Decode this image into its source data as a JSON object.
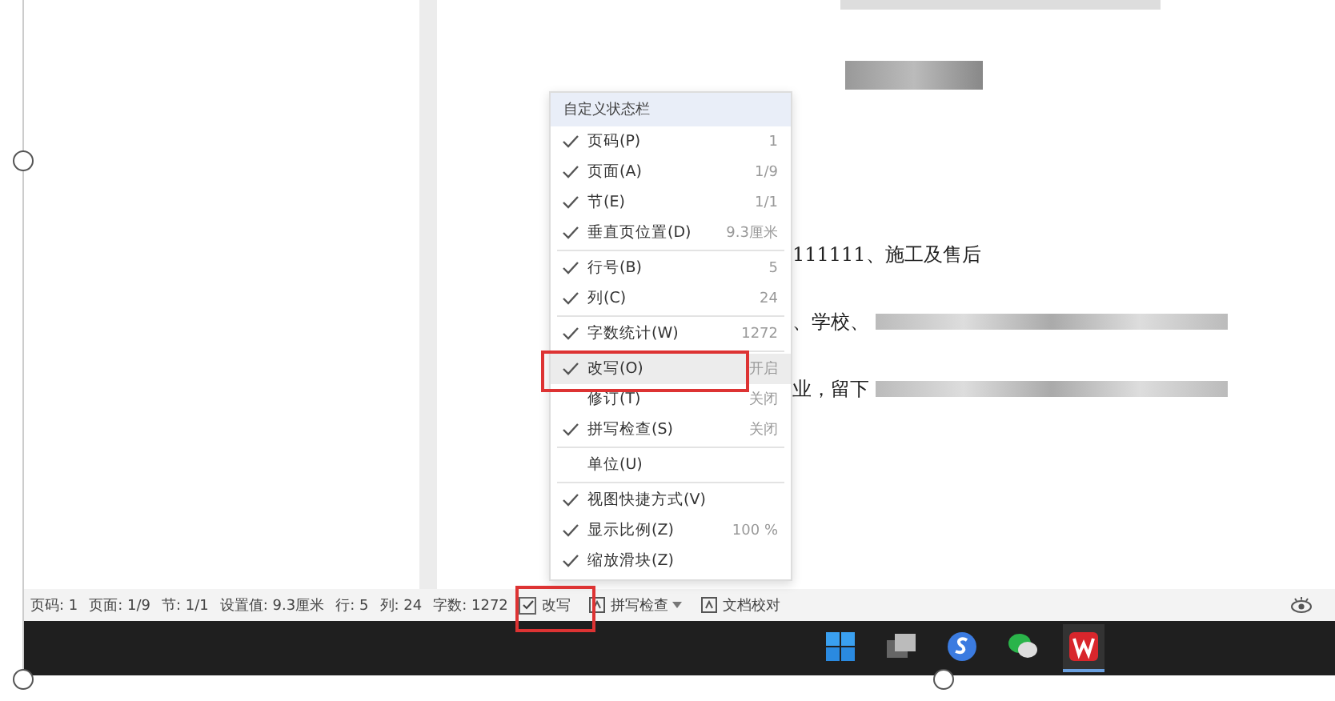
{
  "document": {
    "lines": [
      {
        "text": "111111、施工及售后",
        "blur": false
      },
      {
        "text": "、学校、",
        "blur": true
      },
      {
        "text": "业，留下",
        "blur": true
      }
    ]
  },
  "context_menu": {
    "title": "自定义状态栏",
    "items": [
      {
        "label": "页码(P)",
        "value": "1",
        "checked": true,
        "separator_after": false,
        "selected": false
      },
      {
        "label": "页面(A)",
        "value": "1/9",
        "checked": true,
        "separator_after": false,
        "selected": false
      },
      {
        "label": "节(E)",
        "value": "1/1",
        "checked": true,
        "separator_after": false,
        "selected": false
      },
      {
        "label": "垂直页位置(D)",
        "value": "9.3厘米",
        "checked": true,
        "separator_after": true,
        "selected": false
      },
      {
        "label": "行号(B)",
        "value": "5",
        "checked": true,
        "separator_after": false,
        "selected": false
      },
      {
        "label": "列(C)",
        "value": "24",
        "checked": true,
        "separator_after": true,
        "selected": false
      },
      {
        "label": "字数统计(W)",
        "value": "1272",
        "checked": true,
        "separator_after": true,
        "selected": false
      },
      {
        "label": "改写(O)",
        "value": "开启",
        "checked": true,
        "separator_after": false,
        "selected": true
      },
      {
        "label": "修订(T)",
        "value": "关闭",
        "checked": false,
        "separator_after": false,
        "selected": false
      },
      {
        "label": "拼写检查(S)",
        "value": "关闭",
        "checked": true,
        "separator_after": true,
        "selected": false
      },
      {
        "label": "单位(U)",
        "checked": false,
        "separator_after": true,
        "selected": false
      },
      {
        "label": "视图快捷方式(V)",
        "checked": true,
        "separator_after": false,
        "selected": false
      },
      {
        "label": "显示比例(Z)",
        "value": "100 %",
        "checked": true,
        "separator_after": false,
        "selected": false
      },
      {
        "label": "缩放滑块(Z)",
        "checked": true,
        "separator_after": false,
        "selected": false
      }
    ]
  },
  "status_bar": {
    "fields": [
      "页码: 1",
      "页面: 1/9",
      "节: 1/1",
      "设置值: 9.3厘米",
      "行: 5",
      "列: 24",
      "字数: 1272"
    ],
    "controls": [
      {
        "kind": "checkbox",
        "label": "改写",
        "checked": true
      },
      {
        "kind": "dropdown",
        "label": "拼写检查"
      },
      {
        "kind": "button",
        "label": "文档校对"
      }
    ]
  },
  "taskbar": {
    "apps": [
      {
        "kind": "windows",
        "active": false
      },
      {
        "kind": "gallery",
        "active": false
      },
      {
        "kind": "browser",
        "active": false
      },
      {
        "kind": "chat",
        "active": false
      },
      {
        "kind": "office",
        "active": true
      }
    ]
  }
}
